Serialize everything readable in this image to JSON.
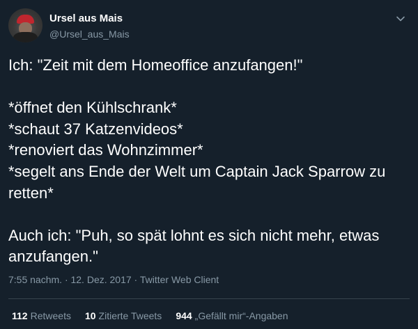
{
  "user": {
    "display_name": "Ursel aus Mais",
    "handle": "@Ursel_aus_Mais"
  },
  "tweet": {
    "text": "Ich: \"Zeit mit dem Homeoffice anzufangen!\"\n\n*öffnet den Kühlschrank*\n*schaut 37 Katzenvideos*\n*renoviert das Wohnzimmer*\n*segelt ans Ende der Welt um Captain Jack Sparrow zu retten*\n\nAuch ich: \"Puh, so spät lohnt es sich nicht mehr, etwas anzufangen.\"",
    "meta": "7:55 nachm. · 12. Dez. 2017 · Twitter Web Client"
  },
  "stats": {
    "retweets_count": "112",
    "retweets_label": "Retweets",
    "quotes_count": "10",
    "quotes_label": "Zitierte Tweets",
    "likes_count": "944",
    "likes_label": "„Gefällt mir“-Angaben"
  },
  "icons": {
    "menu": "chevron-down-icon",
    "avatar": "avatar"
  },
  "colors": {
    "background": "#15202b",
    "text_primary": "#ffffff",
    "text_secondary": "#8899a6",
    "divider": "#38444d"
  }
}
